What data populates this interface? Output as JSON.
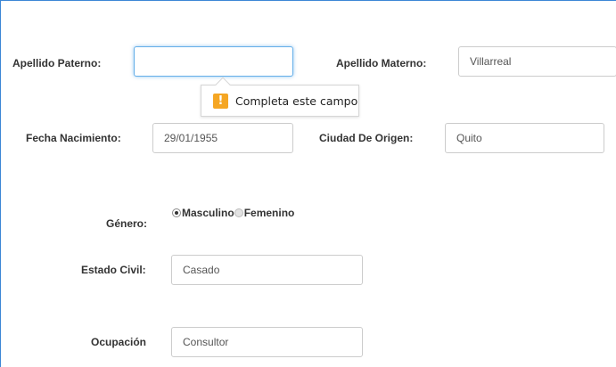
{
  "form": {
    "apellido_paterno": {
      "label": "Apellido Paterno:",
      "value": ""
    },
    "apellido_materno": {
      "label": "Apellido Materno:",
      "value": "Villarreal"
    },
    "fecha_nacimiento": {
      "label": "Fecha Nacimiento:",
      "value": "29/01/1955"
    },
    "ciudad_origen": {
      "label": "Ciudad De Origen:",
      "value": "Quito"
    },
    "genero": {
      "label": "Género:",
      "options": [
        {
          "label": "Masculino",
          "selected": true
        },
        {
          "label": "Femenino",
          "selected": false
        }
      ]
    },
    "estado_civil": {
      "label": "Estado Civil:",
      "value": "Casado"
    },
    "ocupacion": {
      "label": "Ocupación",
      "value": "Consultor"
    }
  },
  "validation_tooltip": {
    "icon": "warning-icon",
    "icon_glyph": "!",
    "message": "Completa este campo"
  },
  "colors": {
    "focus_border": "#66afe9",
    "frame_border": "#3c87d6",
    "warning": "#f5a623"
  }
}
